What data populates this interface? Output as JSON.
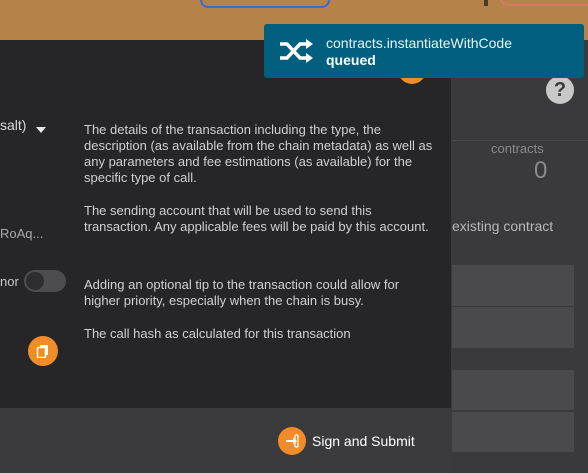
{
  "background_page": {
    "contracts_label": "contracts",
    "contracts_count": "0",
    "existing_contract_text": "existing contract"
  },
  "modal": {
    "left_column": {
      "call_label_fragment": "salt)",
      "account_fragment": "RoAq...",
      "tip_toggle_fragment": "nor"
    },
    "help_texts": [
      "The details of the transaction including the type, the description (as available from the chain metadata) as well as any parameters and fee estimations (as available) for the specific type of call.",
      "The sending account that will be used to send this transaction. Any applicable fees will be paid by this account.",
      "Adding an optional tip to the transaction could allow for higher priority, especially when the chain is busy.",
      "The call hash as calculated for this transaction"
    ],
    "submit_label": "Sign and Submit"
  },
  "toast": {
    "title": "contracts.instantiateWithCode",
    "status": "queued",
    "icon": "shuffle-icon"
  },
  "colors": {
    "accent": "#f28c28",
    "toast_bg": "#005f7f",
    "modal_bg": "#262628",
    "footer_bg": "#3b3b3d",
    "browser_strip": "#b5834a"
  }
}
